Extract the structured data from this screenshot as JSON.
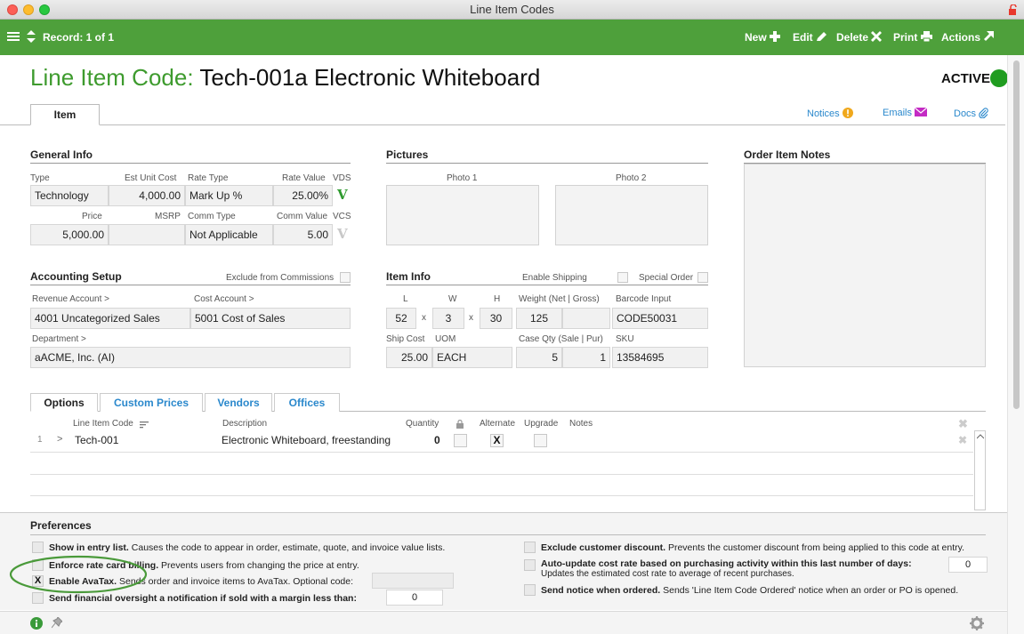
{
  "window": {
    "title": "Line Item Codes"
  },
  "toolbar": {
    "record": "Record: 1 of 1",
    "new": "New",
    "edit": "Edit",
    "delete": "Delete",
    "print": "Print",
    "actions": "Actions"
  },
  "header": {
    "label": "Line Item Code:",
    "value": "Tech-001a Electronic Whiteboard",
    "status": "ACTIVE",
    "status_color": "#1f9c1f"
  },
  "tabs": {
    "item": "Item"
  },
  "links": {
    "notices": "Notices",
    "emails": "Emails",
    "docs": "Docs"
  },
  "general": {
    "title": "General Info",
    "type_label": "Type",
    "type": "Technology",
    "est_label": "Est Unit Cost",
    "est": "4,000.00",
    "rate_type_label": "Rate Type",
    "rate_type": "Mark Up %",
    "rate_value_label": "Rate Value",
    "rate_value": "25.00%",
    "vds_label": "VDS",
    "vds_mark": "V",
    "price_label": "Price",
    "price": "5,000.00",
    "msrp_label": "MSRP",
    "msrp": "",
    "comm_type_label": "Comm Type",
    "comm_type": "Not Applicable",
    "comm_value_label": "Comm Value",
    "comm_value": "5.00",
    "vcs_label": "VCS",
    "vcs_mark": "V"
  },
  "pictures": {
    "title": "Pictures",
    "photo1": "Photo 1",
    "photo2": "Photo 2"
  },
  "notes": {
    "title": "Order Item Notes"
  },
  "accounting": {
    "title": "Accounting Setup",
    "exclude_label": "Exclude from Commissions",
    "revenue_label": "Revenue Account >",
    "revenue": "4001 Uncategorized Sales",
    "cost_label": "Cost Account >",
    "cost": "5001 Cost of Sales",
    "dept_label": "Department >",
    "dept": "aACME, Inc.  (AI)"
  },
  "iteminfo": {
    "title": "Item Info",
    "enable_shipping": "Enable Shipping",
    "special_order": "Special Order",
    "l_label": "L",
    "l": "52",
    "w_label": "W",
    "w": "3",
    "h_label": "H",
    "h": "30",
    "x": "x",
    "weight_label": "Weight (Net | Gross)",
    "weight_net": "125",
    "weight_gross": "",
    "barcode_label": "Barcode Input",
    "barcode": "CODE50031",
    "ship_label": "Ship Cost",
    "ship": "25.00",
    "uom_label": "UOM",
    "uom": "EACH",
    "case_label": "Case Qty (Sale | Pur)",
    "case_sale": "5",
    "case_pur": "1",
    "sku_label": "SKU",
    "sku": "13584695"
  },
  "options_tabs": [
    "Options",
    "Custom Prices",
    "Vendors",
    "Offices"
  ],
  "grid": {
    "headers": {
      "code": "Line Item Code",
      "desc": "Description",
      "qty": "Quantity",
      "alt": "Alternate",
      "upg": "Upgrade",
      "notes": "Notes"
    },
    "rows": [
      {
        "num": "1",
        "arrow": ">",
        "code": "Tech-001",
        "desc": "Electronic Whiteboard, freestanding",
        "qty": "0",
        "alt": "X"
      }
    ]
  },
  "preferences": {
    "title": "Preferences",
    "p1_b": "Show in entry list.",
    "p1": " Causes the code to appear in order, estimate, quote, and invoice value lists.",
    "p2_b": "Enforce rate card billing.",
    "p2": " Prevents users from changing the price at entry.",
    "p3_b": "Enable AvaTax.",
    "p3": " Sends order and invoice items to AvaTax. Optional code:",
    "p3_check": "X",
    "p4_b": "Send financial oversight a notification if sold with a margin less than:",
    "p4_val": "0",
    "p5_b": "Exclude customer discount.",
    "p5": " Prevents the customer discount from being applied to this code at entry.",
    "p6_b": "Auto-update cost rate based on purchasing activity within this last number of days:",
    "p6_val": "0",
    "p6_sub": "Updates the estimated cost rate to average of recent purchases.",
    "p7_b": "Send notice when ordered.",
    "p7": " Sends 'Line Item Code Ordered' notice when an order or PO is opened."
  },
  "colors": {
    "toolbar": "#4ea03b",
    "accent": "#3e9b2e",
    "link": "#2a88cc",
    "highlight_circle": "#4a9a3a"
  }
}
